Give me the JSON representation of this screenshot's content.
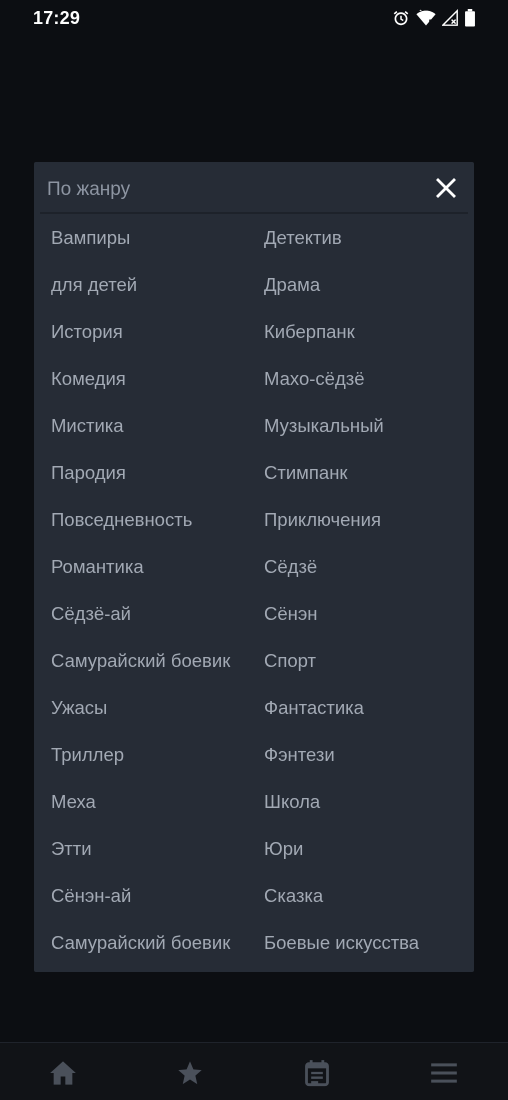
{
  "status_bar": {
    "time": "17:29",
    "icons": [
      "alarm-icon",
      "wifi-icon",
      "signal-icon",
      "battery-icon"
    ]
  },
  "modal": {
    "title": "По жанру",
    "close_icon": "close-icon",
    "genres": [
      "Вампиры",
      "Детектив",
      "для детей",
      "Драма",
      "История",
      "Киберпанк",
      "Комедия",
      "Махо-сёдзё",
      "Мистика",
      "Музыкальный",
      "Пародия",
      "Стимпанк",
      "Повседневность",
      "Приключения",
      "Романтика",
      "Сёдзё",
      "Сёдзё-ай",
      "Сёнэн",
      "Самурайский боевик",
      "Спорт",
      "Ужасы",
      "Фантастика",
      "Триллер",
      "Фэнтези",
      "Меха",
      "Школа",
      "Этти",
      "Юри",
      "Сёнэн-ай",
      "Сказка",
      "Самурайский боевик",
      "Боевые искусства"
    ]
  },
  "bottom_nav": {
    "items": [
      "home-icon",
      "star-icon",
      "calendar-icon",
      "menu-icon"
    ]
  },
  "colors": {
    "background": "#0c0e12",
    "modal_bg": "#262c36",
    "genre_text": "#a2a9b4",
    "title_text": "#8d95a2",
    "nav_icon": "#4a505a"
  }
}
